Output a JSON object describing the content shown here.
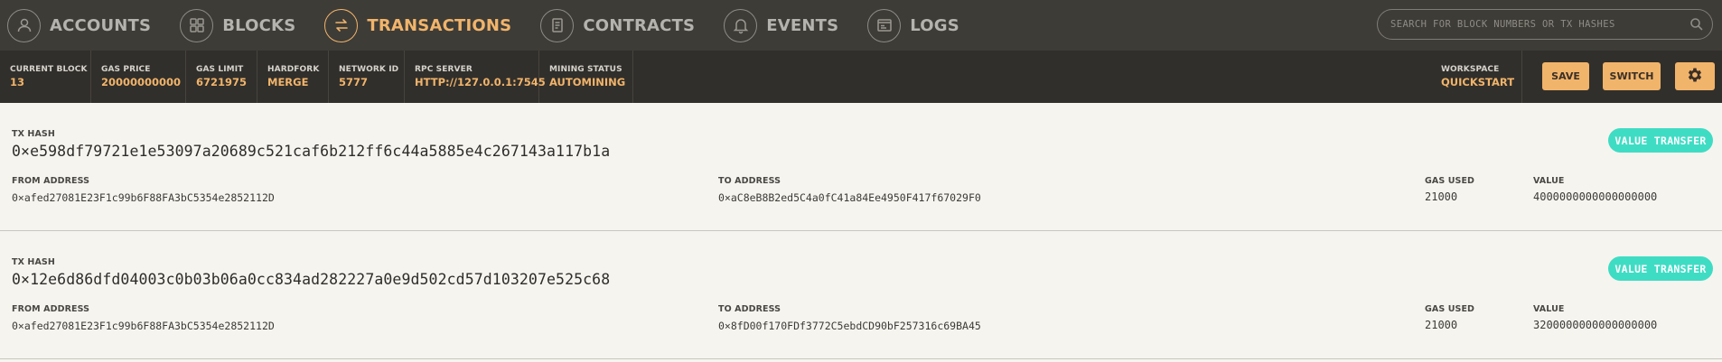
{
  "nav": {
    "items": [
      {
        "label": "ACCOUNTS",
        "icon": "user-icon"
      },
      {
        "label": "BLOCKS",
        "icon": "grid-icon"
      },
      {
        "label": "TRANSACTIONS",
        "icon": "swap-arrows-icon",
        "active": true
      },
      {
        "label": "CONTRACTS",
        "icon": "document-icon"
      },
      {
        "label": "EVENTS",
        "icon": "bell-icon"
      },
      {
        "label": "LOGS",
        "icon": "terminal-icon"
      }
    ],
    "search_placeholder": "SEARCH FOR BLOCK NUMBERS OR TX HASHES"
  },
  "status": {
    "current_block": {
      "label": "CURRENT BLOCK",
      "value": "13"
    },
    "gas_price": {
      "label": "GAS PRICE",
      "value": "20000000000"
    },
    "gas_limit": {
      "label": "GAS LIMIT",
      "value": "6721975"
    },
    "hardfork": {
      "label": "HARDFORK",
      "value": "MERGE"
    },
    "network_id": {
      "label": "NETWORK ID",
      "value": "5777"
    },
    "rpc_server": {
      "label": "RPC SERVER",
      "value": "HTTP://127.0.0.1:7545"
    },
    "mining_status": {
      "label": "MINING STATUS",
      "value": "AUTOMINING"
    },
    "workspace": {
      "label": "WORKSPACE",
      "value": "QUICKSTART"
    },
    "save_label": "SAVE",
    "switch_label": "SWITCH"
  },
  "labels": {
    "tx_hash": "TX HASH",
    "from_address": "FROM ADDRESS",
    "to_address": "TO ADDRESS",
    "gas_used": "GAS USED",
    "value": "VALUE"
  },
  "transactions": [
    {
      "hash": "0×e598df79721e1e53097a20689c521caf6b212ff6c44a5885e4c267143a117b1a",
      "from": "0×afed27081E23F1c99b6F88FA3bC5354e2852112D",
      "to": "0×aC8eB8B2ed5C4a0fC41a84Ee4950F417f67029F0",
      "gas_used": "21000",
      "value": "4000000000000000000",
      "type": "VALUE TRANSFER"
    },
    {
      "hash": "0×12e6d86dfd04003c0b03b06a0cc834ad282227a0e9d502cd57d103207e525c68",
      "from": "0×afed27081E23F1c99b6F88FA3bC5354e2852112D",
      "to": "0×8fD00f170FDf3772C5ebdCD90bF257316c69BA45",
      "gas_used": "21000",
      "value": "3200000000000000000",
      "type": "VALUE TRANSFER"
    }
  ],
  "colors": {
    "nav_bg": "#3e3c37",
    "status_bg": "#312f2b",
    "accent": "#f1b46b",
    "badge": "#3fdcc4",
    "content_bg": "#f6f4ef"
  }
}
